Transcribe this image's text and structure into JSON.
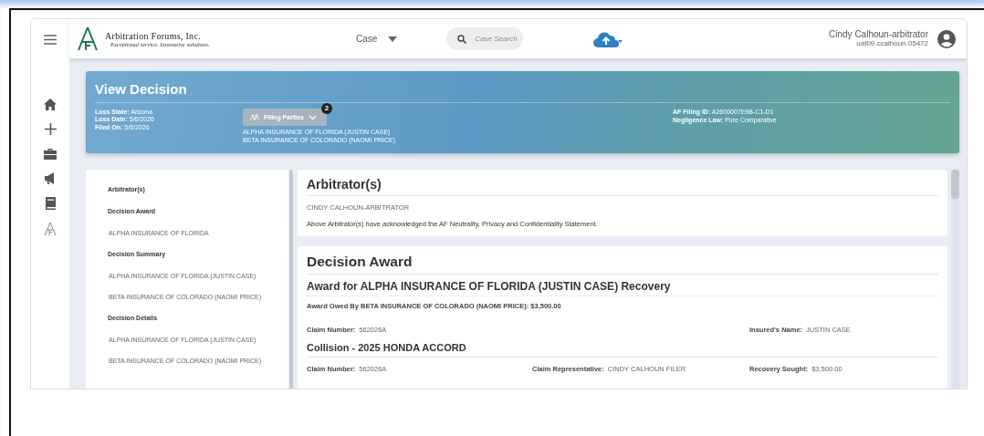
{
  "header": {
    "logo": {
      "name": "Arbitration Forums, Inc.",
      "tagline": "Exceptional service. Innovative solutions."
    },
    "case_dropdown": "Case",
    "search": {
      "placeholder": "Case Search"
    },
    "user": {
      "name": "Cindy Calhoun-arbitrator",
      "id": "uat09.ccalhoun.05472"
    }
  },
  "banner": {
    "title": "View Decision",
    "left_fields": [
      {
        "label": "Loss State:",
        "value": "Arizona"
      },
      {
        "label": "Loss Date:",
        "value": "5/6/2026"
      },
      {
        "label": "Filed On:",
        "value": "5/6/2026"
      }
    ],
    "filing_parties": {
      "label": "Filing Parties",
      "badge": "2",
      "parties": [
        "ALPHA INSURANCE OF FLORIDA (JUSTIN CASE)",
        "BETA INSURANCE OF COLORADO (NAOMI PRICE)"
      ]
    },
    "right_fields": [
      {
        "label": "AF Filing ID:",
        "value": "A2600007E9B-C1-D1"
      },
      {
        "label": "Negligence Law:",
        "value": "Pure Comparative"
      }
    ]
  },
  "nav": [
    {
      "kind": "heading",
      "label": "Arbitrator(s)"
    },
    {
      "kind": "heading",
      "label": "Decision Award"
    },
    {
      "kind": "sub",
      "label": "ALPHA INSURANCE OF FLORIDA"
    },
    {
      "kind": "heading",
      "label": "Decision Summary"
    },
    {
      "kind": "sub",
      "label": "ALPHA INSURANCE OF FLORIDA (JUSTIN CASE)"
    },
    {
      "kind": "sub",
      "label": "BETA INSURANCE OF COLORADO (NAOMI PRICE)"
    },
    {
      "kind": "heading",
      "label": "Decision Details"
    },
    {
      "kind": "sub",
      "label": "ALPHA INSURANCE OF FLORIDA (JUSTIN CASE)"
    },
    {
      "kind": "sub",
      "label": "BETA INSURANCE OF COLORADO (NAOMI PRICE)"
    }
  ],
  "arbitrators": {
    "title": "Arbitrator(s)",
    "names": [
      "CINDY CALHOUN-ARBITRATOR"
    ],
    "statement": "Above Arbitrator(s) have acknowledged the AF Neutrality, Privacy and Confidentiality Statement."
  },
  "award": {
    "title": "Decision Award",
    "subtitle": "Award for ALPHA INSURANCE OF FLORIDA (JUSTIN CASE) Recovery",
    "owed": "Award Owed By BETA INSURANCE OF COLORADO (NAOMI PRICE): $3,500.00",
    "claim_fields": [
      {
        "label": "Claim Number:",
        "value": "562026A"
      },
      {
        "label": "Insured's Name:",
        "value": "JUSTIN CASE"
      }
    ],
    "vehicle": {
      "title": "Collision - 2025 HONDA ACCORD",
      "fields": [
        {
          "label": "Claim Number:",
          "value": "562026A"
        },
        {
          "label": "Claim Representative:",
          "value": "CINDY CALHOUN FILER"
        },
        {
          "label": "Recovery Sought:",
          "value": "$3,500.00"
        }
      ]
    }
  }
}
